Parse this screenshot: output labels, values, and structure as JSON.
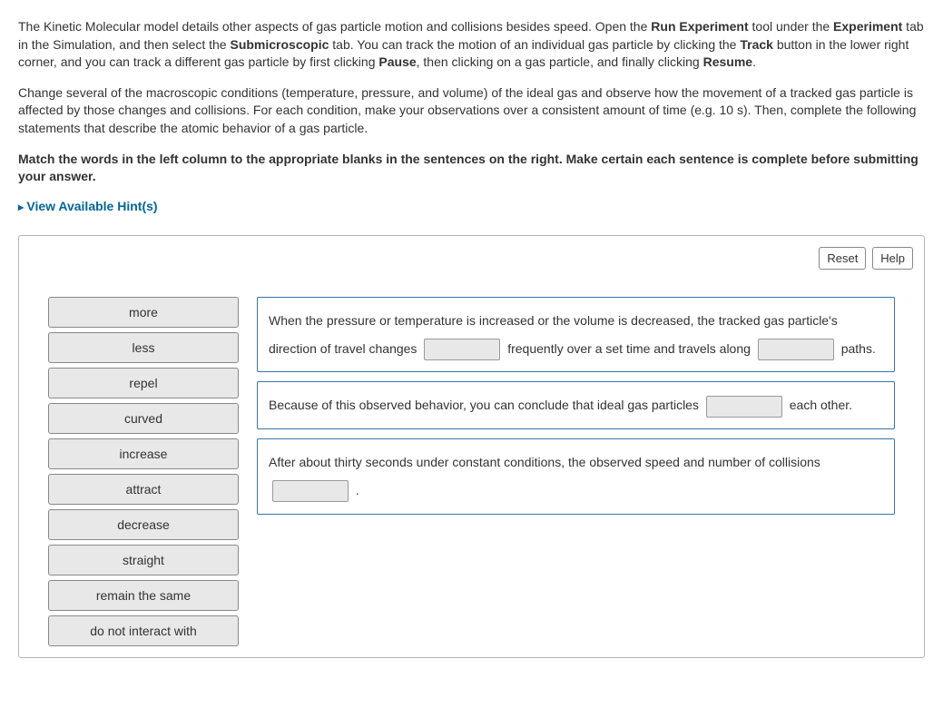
{
  "intro": {
    "p1_a": "The Kinetic Molecular model details other aspects of gas particle motion and collisions besides speed. Open the ",
    "p1_b": "Run Experiment",
    "p1_c": " tool under the ",
    "p1_d": "Experiment",
    "p1_e": " tab in the Simulation, and then select the ",
    "p1_f": "Submicroscopic",
    "p1_g": " tab. You can track the motion of an individual gas particle by clicking the ",
    "p1_h": "Track",
    "p1_i": " button in the lower right corner, and you can track a different gas particle by first clicking ",
    "p1_j": "Pause",
    "p1_k": ", then clicking on a gas particle, and finally clicking ",
    "p1_l": "Resume",
    "p1_m": ".",
    "p2": "Change several of the macroscopic conditions (temperature, pressure, and volume) of the ideal gas and observe how the movement of a tracked gas particle is affected by those changes and collisions. For each condition, make your observations over a consistent amount of time (e.g. 10 s). Then, complete the following statements that describe the atomic behavior of a gas particle."
  },
  "instruction": "Match the words in the left column to the appropriate blanks in the sentences on the right. Make certain each sentence is complete before submitting your answer.",
  "hints_label": "View Available Hint(s)",
  "buttons": {
    "reset": "Reset",
    "help": "Help"
  },
  "word_bank": [
    "more",
    "less",
    "repel",
    "curved",
    "increase",
    "attract",
    "decrease",
    "straight",
    "remain the same",
    "do not interact with"
  ],
  "sentences": {
    "s1_a": "When the pressure or temperature is increased or the volume is decreased, the tracked gas particle's direction of travel changes ",
    "s1_b": " frequently over a set time and travels along ",
    "s1_c": " paths.",
    "s2_a": "Because of this observed behavior, you can conclude that ideal gas particles ",
    "s2_b": " each other.",
    "s3_a": "After about thirty seconds under constant conditions, the observed speed and number of collisions ",
    "s3_b": " ."
  }
}
